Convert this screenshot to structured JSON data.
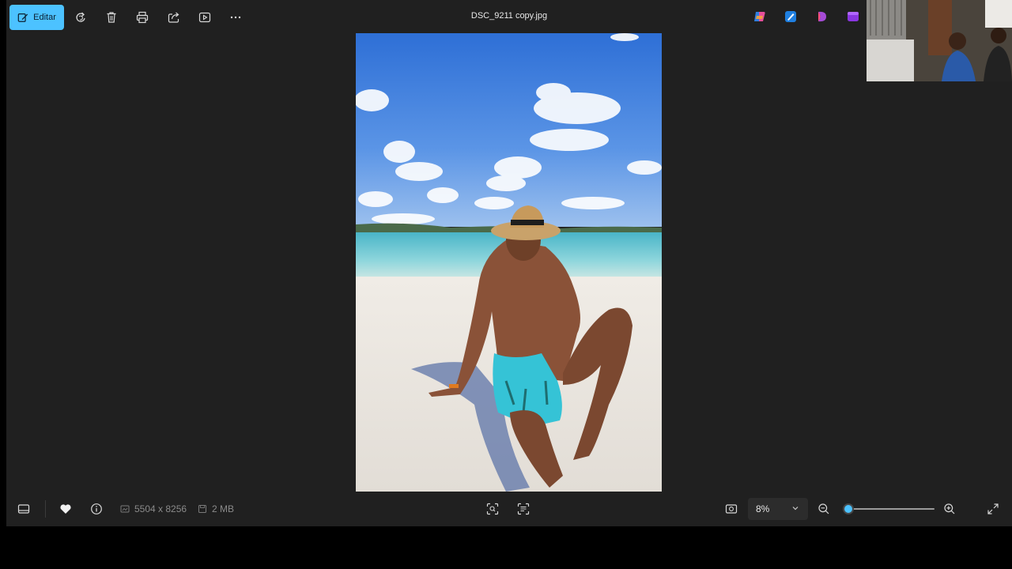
{
  "toolbar": {
    "edit_label": "Editar",
    "icons": [
      "edit-icon",
      "rotate-icon",
      "delete-icon",
      "print-icon",
      "share-icon",
      "slideshow-icon",
      "more-icon"
    ]
  },
  "title": "DSC_9211 copy.jpg",
  "app_icons": [
    "copilot-icon",
    "designer-icon",
    "clipchamp-icon",
    "video-editor-icon"
  ],
  "bottom": {
    "dimensions": "5504 x 8256",
    "file_size": "2 MB",
    "zoom_value": "8%",
    "zoom_level": 0.0,
    "icons": [
      "filmstrip-icon",
      "favorite-heart-icon",
      "info-icon",
      "visual-search-icon",
      "scan-text-icon",
      "fit-to-window-icon",
      "zoom-out-icon",
      "zoom-in-icon",
      "fullscreen-icon"
    ]
  },
  "colors": {
    "accent": "#4cc2ff",
    "background": "#202020",
    "outer": "#000000"
  }
}
